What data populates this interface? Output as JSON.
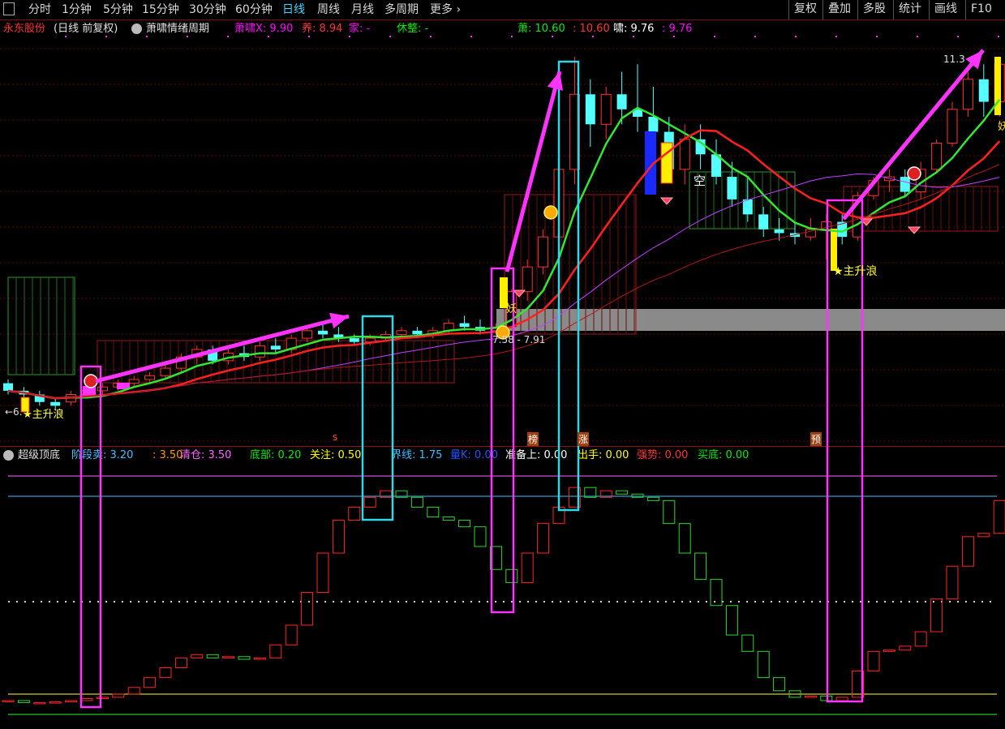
{
  "toolbar": {
    "periods": [
      "分时",
      "1分钟",
      "5分钟",
      "15分钟",
      "30分钟",
      "60分钟",
      "日线",
      "周线",
      "月线",
      "多周期",
      "更多"
    ],
    "active_period": "日线",
    "right_buttons": [
      "复权",
      "叠加",
      "多股",
      "统计",
      "画线",
      "F10"
    ]
  },
  "main_info": {
    "stock_name": "永东股份",
    "mode": "(日线 前复权)",
    "indicator_name": "萧啸情绪周期",
    "items": [
      {
        "label": "萧啸X:",
        "value": "9.90",
        "color": "#ff00ff"
      },
      {
        "label": "养:",
        "value": "8.94",
        "color": "#ff3333"
      },
      {
        "label": "家:",
        "value": "-",
        "color": "#ff00ff"
      },
      {
        "label": "休整:",
        "value": "-",
        "color": "#00ee00"
      },
      {
        "label": "萧:",
        "value": "10.60",
        "color": "#00ee00"
      },
      {
        "label": ":",
        "value": "10.60",
        "color": "#ff3333"
      },
      {
        "label": "啸:",
        "value": "9.76",
        "color": "#ffffff"
      },
      {
        "label": ":",
        "value": "9.76",
        "color": "#ff00ff"
      }
    ]
  },
  "sub_info": {
    "indicator_name": "超级顶底",
    "items": [
      {
        "label": "阶段卖:",
        "value": "3.20",
        "color": "#40c0ff"
      },
      {
        "label": ":",
        "value": "3.50",
        "color": "#ff9900"
      },
      {
        "label": "清仓:",
        "value": "3.50",
        "color": "#ff66ff"
      },
      {
        "label": "底部:",
        "value": "0.20",
        "color": "#00ee00"
      },
      {
        "label": "关注:",
        "value": "0.50",
        "color": "#ffff00"
      },
      {
        "label": "界线:",
        "value": "1.75",
        "color": "#40c0ff"
      },
      {
        "label": "量K:",
        "value": "0.00",
        "color": "#2255ff"
      },
      {
        "label": "准备上:",
        "value": "0.00",
        "color": "#ffffff"
      },
      {
        "label": "出手:",
        "value": "0.00",
        "color": "#ffff00"
      },
      {
        "label": "强势:",
        "value": "0.00",
        "color": "#ff3333"
      },
      {
        "label": "买底:",
        "value": "0.00",
        "color": "#00ee00"
      }
    ]
  },
  "annotations": {
    "price_high": "11.3",
    "price_range": "7.58 - 7.91",
    "low_marker": "←6.",
    "wave_label_1": "★主升浪",
    "wave_label_2": "★主升浪",
    "wave_label_3": "★主升浪",
    "kong": "空",
    "duo": "多",
    "yao": "妖",
    "tag_bang": "榜",
    "tag_zhang": "涨",
    "tag_yu": "预",
    "tag_s": "s",
    "tag_edge": "妖"
  },
  "colors": {
    "up": "#ff3232",
    "down": "#54ffff",
    "ma_green": "#32e632",
    "ma_red": "#ff2020",
    "ma_purple": "#c040ff",
    "highlight_magenta": "#ff33ff",
    "highlight_cyan": "#33d6e6"
  },
  "chart_data": [
    {
      "type": "candlestick",
      "name": "main",
      "candles": [
        [
          7.05,
          7.1,
          6.9,
          6.95
        ],
        [
          6.95,
          7.0,
          6.85,
          6.9
        ],
        [
          6.9,
          6.95,
          6.75,
          6.8
        ],
        [
          6.8,
          6.85,
          6.7,
          6.75
        ],
        [
          6.8,
          6.95,
          6.75,
          6.9
        ],
        [
          6.9,
          7.0,
          6.85,
          6.95
        ],
        [
          6.95,
          7.05,
          6.9,
          7.0
        ],
        [
          7.0,
          7.1,
          6.95,
          7.05
        ],
        [
          7.05,
          7.15,
          7.0,
          7.1
        ],
        [
          7.1,
          7.2,
          7.05,
          7.15
        ],
        [
          7.15,
          7.3,
          7.1,
          7.25
        ],
        [
          7.25,
          7.45,
          7.2,
          7.4
        ],
        [
          7.4,
          7.55,
          7.3,
          7.5
        ],
        [
          7.5,
          7.55,
          7.3,
          7.35
        ],
        [
          7.35,
          7.5,
          7.3,
          7.45
        ],
        [
          7.45,
          7.55,
          7.35,
          7.4
        ],
        [
          7.4,
          7.6,
          7.35,
          7.55
        ],
        [
          7.55,
          7.65,
          7.45,
          7.5
        ],
        [
          7.5,
          7.7,
          7.45,
          7.65
        ],
        [
          7.65,
          7.8,
          7.6,
          7.75
        ],
        [
          7.75,
          7.85,
          7.65,
          7.7
        ],
        [
          7.7,
          7.8,
          7.6,
          7.65
        ],
        [
          7.65,
          7.7,
          7.55,
          7.6
        ],
        [
          7.6,
          7.7,
          7.55,
          7.65
        ],
        [
          7.65,
          7.75,
          7.6,
          7.7
        ],
        [
          7.7,
          7.8,
          7.65,
          7.75
        ],
        [
          7.75,
          7.8,
          7.65,
          7.7
        ],
        [
          7.7,
          7.8,
          7.65,
          7.75
        ],
        [
          7.75,
          7.9,
          7.7,
          7.85
        ],
        [
          7.85,
          7.95,
          7.75,
          7.8
        ],
        [
          7.8,
          7.9,
          7.7,
          7.75
        ],
        [
          7.75,
          7.85,
          7.7,
          7.8
        ],
        [
          7.8,
          8.3,
          7.8,
          8.27
        ],
        [
          8.27,
          8.7,
          8.15,
          8.6
        ],
        [
          8.6,
          9.1,
          8.5,
          9.0
        ],
        [
          9.0,
          10.0,
          8.9,
          9.9
        ],
        [
          9.9,
          11.4,
          9.7,
          10.9
        ],
        [
          10.9,
          11.1,
          10.2,
          10.5
        ],
        [
          10.5,
          11.0,
          10.3,
          10.9
        ],
        [
          10.9,
          11.2,
          10.5,
          10.7
        ],
        [
          10.7,
          11.3,
          10.4,
          10.6
        ],
        [
          10.6,
          11.0,
          10.3,
          10.4
        ],
        [
          10.4,
          10.6,
          9.8,
          9.9
        ],
        [
          9.9,
          10.5,
          9.7,
          10.3
        ],
        [
          10.3,
          10.5,
          9.9,
          10.1
        ],
        [
          10.1,
          10.3,
          9.7,
          9.8
        ],
        [
          9.8,
          10.0,
          9.4,
          9.5
        ],
        [
          9.5,
          9.8,
          9.2,
          9.3
        ],
        [
          9.3,
          9.4,
          9.0,
          9.1
        ],
        [
          9.1,
          9.25,
          8.95,
          9.05
        ],
        [
          9.05,
          9.2,
          8.9,
          9.0
        ],
        [
          9.0,
          9.25,
          8.95,
          9.1
        ],
        [
          9.1,
          9.3,
          8.7,
          9.2
        ],
        [
          9.2,
          9.3,
          8.9,
          9.0
        ],
        [
          9.0,
          9.6,
          8.95,
          9.55
        ],
        [
          9.55,
          9.8,
          9.5,
          9.75
        ],
        [
          9.75,
          9.9,
          9.6,
          9.8
        ],
        [
          9.8,
          9.9,
          9.55,
          9.6
        ],
        [
          9.6,
          10.0,
          9.5,
          9.9
        ],
        [
          9.9,
          10.3,
          9.85,
          10.25
        ],
        [
          10.25,
          10.8,
          10.2,
          10.7
        ],
        [
          10.7,
          11.2,
          10.6,
          11.1
        ],
        [
          11.1,
          11.3,
          10.6,
          10.8
        ],
        [
          10.8,
          11.35,
          10.6,
          11.3
        ]
      ]
    },
    {
      "type": "bar",
      "name": "超级顶底",
      "values": [
        0.05,
        0.02,
        0.02,
        0.03,
        0.05,
        0.08,
        0.1,
        0.15,
        0.25,
        0.4,
        0.55,
        0.7,
        0.75,
        0.7,
        0.72,
        0.68,
        0.7,
        0.9,
        1.2,
        1.7,
        2.3,
        2.8,
        3.0,
        3.15,
        3.25,
        3.15,
        3.0,
        2.85,
        2.8,
        2.7,
        2.4,
        2.05,
        1.85,
        2.3,
        2.75,
        3.0,
        3.3,
        3.15,
        3.25,
        3.2,
        3.15,
        3.1,
        2.75,
        2.3,
        1.9,
        1.5,
        1.05,
        0.8,
        0.4,
        0.2,
        0.1,
        0.12,
        0.05,
        0.1,
        0.5,
        0.8,
        0.82,
        0.88,
        1.1,
        1.6,
        2.1,
        2.55,
        2.6,
        3.1
      ],
      "ylim": [
        0,
        3.5
      ]
    }
  ]
}
